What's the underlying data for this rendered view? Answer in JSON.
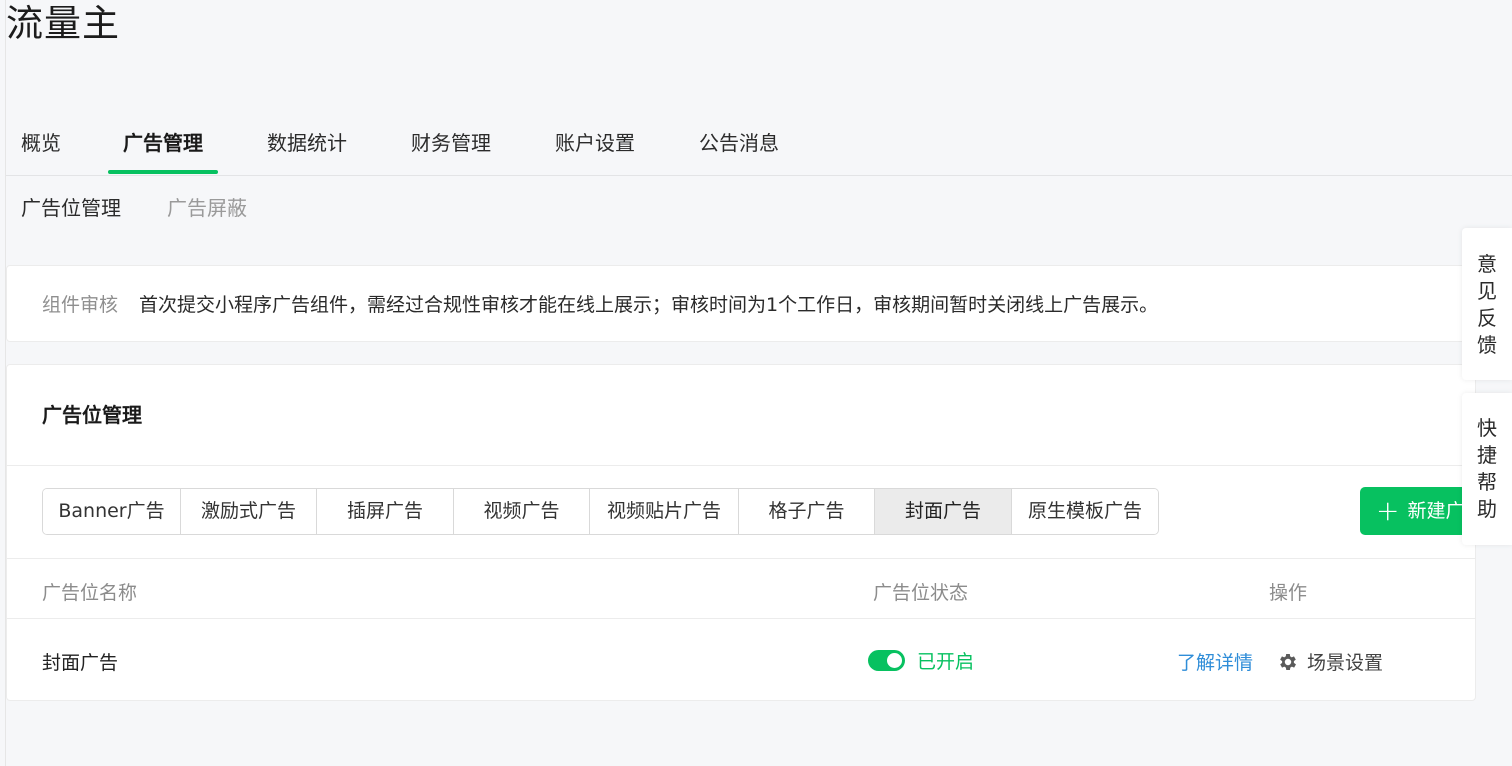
{
  "app": {
    "title": "流量主"
  },
  "main_nav": {
    "tabs": [
      {
        "label": "概览"
      },
      {
        "label": "广告管理",
        "active": true
      },
      {
        "label": "数据统计"
      },
      {
        "label": "财务管理"
      },
      {
        "label": "账户设置"
      },
      {
        "label": "公告消息"
      }
    ]
  },
  "sub_nav": {
    "items": [
      {
        "label": "广告位管理",
        "active": true
      },
      {
        "label": "广告屏蔽",
        "active": false
      }
    ]
  },
  "notice": {
    "label": "组件审核",
    "text": "首次提交小程序广告组件，需经过合规性审核才能在线上展示；审核时间为1个工作日，审核期间暂时关闭线上广告展示。"
  },
  "ad_slots": {
    "title": "广告位管理",
    "types": [
      {
        "label": "Banner广告"
      },
      {
        "label": "激励式广告"
      },
      {
        "label": "插屏广告"
      },
      {
        "label": "视频广告"
      },
      {
        "label": "视频贴片广告"
      },
      {
        "label": "格子广告"
      },
      {
        "label": "封面广告",
        "selected": true
      },
      {
        "label": "原生模板广告"
      }
    ],
    "new_button_label": "新建广",
    "table": {
      "headers": {
        "name": "广告位名称",
        "status": "广告位状态",
        "actions": "操作"
      },
      "rows": [
        {
          "name": "封面广告",
          "status": "已开启",
          "enabled": true,
          "detail_link": "了解详情",
          "scene_settings": "场景设置"
        }
      ]
    }
  },
  "float_panel": {
    "feedback": "意见反馈",
    "help": "快捷帮助"
  },
  "colors": {
    "accent": "#07c160",
    "link": "#2f8dd8"
  },
  "icons": {
    "new_button": "plus-icon",
    "scene_settings": "gear-icon"
  }
}
